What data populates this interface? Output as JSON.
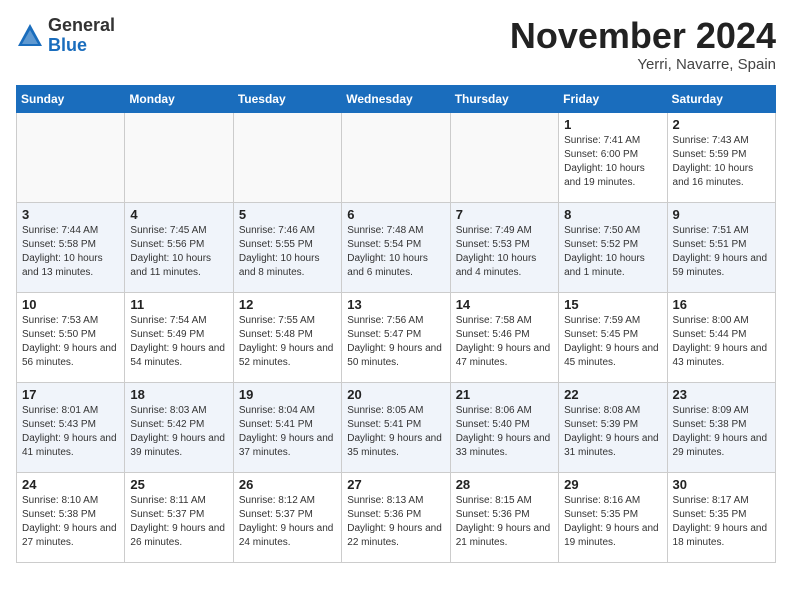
{
  "header": {
    "logo_general": "General",
    "logo_blue": "Blue",
    "month_title": "November 2024",
    "location": "Yerri, Navarre, Spain"
  },
  "weekdays": [
    "Sunday",
    "Monday",
    "Tuesday",
    "Wednesday",
    "Thursday",
    "Friday",
    "Saturday"
  ],
  "weeks": [
    {
      "rowClass": "row-odd",
      "days": [
        {
          "num": "",
          "info": ""
        },
        {
          "num": "",
          "info": ""
        },
        {
          "num": "",
          "info": ""
        },
        {
          "num": "",
          "info": ""
        },
        {
          "num": "",
          "info": ""
        },
        {
          "num": "1",
          "info": "Sunrise: 7:41 AM\nSunset: 6:00 PM\nDaylight: 10 hours and 19 minutes."
        },
        {
          "num": "2",
          "info": "Sunrise: 7:43 AM\nSunset: 5:59 PM\nDaylight: 10 hours and 16 minutes."
        }
      ]
    },
    {
      "rowClass": "row-even",
      "days": [
        {
          "num": "3",
          "info": "Sunrise: 7:44 AM\nSunset: 5:58 PM\nDaylight: 10 hours and 13 minutes."
        },
        {
          "num": "4",
          "info": "Sunrise: 7:45 AM\nSunset: 5:56 PM\nDaylight: 10 hours and 11 minutes."
        },
        {
          "num": "5",
          "info": "Sunrise: 7:46 AM\nSunset: 5:55 PM\nDaylight: 10 hours and 8 minutes."
        },
        {
          "num": "6",
          "info": "Sunrise: 7:48 AM\nSunset: 5:54 PM\nDaylight: 10 hours and 6 minutes."
        },
        {
          "num": "7",
          "info": "Sunrise: 7:49 AM\nSunset: 5:53 PM\nDaylight: 10 hours and 4 minutes."
        },
        {
          "num": "8",
          "info": "Sunrise: 7:50 AM\nSunset: 5:52 PM\nDaylight: 10 hours and 1 minute."
        },
        {
          "num": "9",
          "info": "Sunrise: 7:51 AM\nSunset: 5:51 PM\nDaylight: 9 hours and 59 minutes."
        }
      ]
    },
    {
      "rowClass": "row-odd",
      "days": [
        {
          "num": "10",
          "info": "Sunrise: 7:53 AM\nSunset: 5:50 PM\nDaylight: 9 hours and 56 minutes."
        },
        {
          "num": "11",
          "info": "Sunrise: 7:54 AM\nSunset: 5:49 PM\nDaylight: 9 hours and 54 minutes."
        },
        {
          "num": "12",
          "info": "Sunrise: 7:55 AM\nSunset: 5:48 PM\nDaylight: 9 hours and 52 minutes."
        },
        {
          "num": "13",
          "info": "Sunrise: 7:56 AM\nSunset: 5:47 PM\nDaylight: 9 hours and 50 minutes."
        },
        {
          "num": "14",
          "info": "Sunrise: 7:58 AM\nSunset: 5:46 PM\nDaylight: 9 hours and 47 minutes."
        },
        {
          "num": "15",
          "info": "Sunrise: 7:59 AM\nSunset: 5:45 PM\nDaylight: 9 hours and 45 minutes."
        },
        {
          "num": "16",
          "info": "Sunrise: 8:00 AM\nSunset: 5:44 PM\nDaylight: 9 hours and 43 minutes."
        }
      ]
    },
    {
      "rowClass": "row-even",
      "days": [
        {
          "num": "17",
          "info": "Sunrise: 8:01 AM\nSunset: 5:43 PM\nDaylight: 9 hours and 41 minutes."
        },
        {
          "num": "18",
          "info": "Sunrise: 8:03 AM\nSunset: 5:42 PM\nDaylight: 9 hours and 39 minutes."
        },
        {
          "num": "19",
          "info": "Sunrise: 8:04 AM\nSunset: 5:41 PM\nDaylight: 9 hours and 37 minutes."
        },
        {
          "num": "20",
          "info": "Sunrise: 8:05 AM\nSunset: 5:41 PM\nDaylight: 9 hours and 35 minutes."
        },
        {
          "num": "21",
          "info": "Sunrise: 8:06 AM\nSunset: 5:40 PM\nDaylight: 9 hours and 33 minutes."
        },
        {
          "num": "22",
          "info": "Sunrise: 8:08 AM\nSunset: 5:39 PM\nDaylight: 9 hours and 31 minutes."
        },
        {
          "num": "23",
          "info": "Sunrise: 8:09 AM\nSunset: 5:38 PM\nDaylight: 9 hours and 29 minutes."
        }
      ]
    },
    {
      "rowClass": "row-odd",
      "days": [
        {
          "num": "24",
          "info": "Sunrise: 8:10 AM\nSunset: 5:38 PM\nDaylight: 9 hours and 27 minutes."
        },
        {
          "num": "25",
          "info": "Sunrise: 8:11 AM\nSunset: 5:37 PM\nDaylight: 9 hours and 26 minutes."
        },
        {
          "num": "26",
          "info": "Sunrise: 8:12 AM\nSunset: 5:37 PM\nDaylight: 9 hours and 24 minutes."
        },
        {
          "num": "27",
          "info": "Sunrise: 8:13 AM\nSunset: 5:36 PM\nDaylight: 9 hours and 22 minutes."
        },
        {
          "num": "28",
          "info": "Sunrise: 8:15 AM\nSunset: 5:36 PM\nDaylight: 9 hours and 21 minutes."
        },
        {
          "num": "29",
          "info": "Sunrise: 8:16 AM\nSunset: 5:35 PM\nDaylight: 9 hours and 19 minutes."
        },
        {
          "num": "30",
          "info": "Sunrise: 8:17 AM\nSunset: 5:35 PM\nDaylight: 9 hours and 18 minutes."
        }
      ]
    }
  ]
}
